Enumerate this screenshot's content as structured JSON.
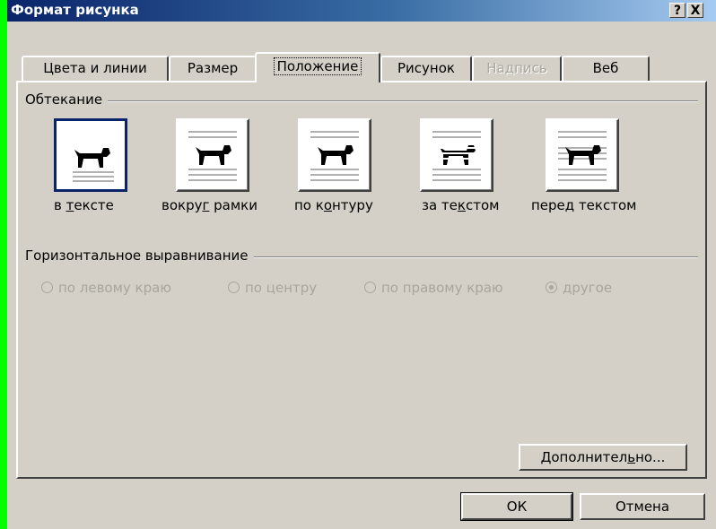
{
  "window": {
    "title": "Формат рисунка",
    "help_label": "?",
    "close_label": "X"
  },
  "tabs": [
    {
      "label": "Цвета и линии",
      "state": "normal"
    },
    {
      "label": "Размер",
      "state": "normal"
    },
    {
      "label": "Положение",
      "state": "active"
    },
    {
      "label": "Рисунок",
      "state": "normal"
    },
    {
      "label": "Надпись",
      "state": "disabled"
    },
    {
      "label": "Веб",
      "state": "normal"
    }
  ],
  "wrapping": {
    "group_label": "Обтекание",
    "options": [
      {
        "label_pre": "в ",
        "label_ul": "т",
        "label_post": "ексте",
        "icon": "wrap-inline-icon",
        "selected": true
      },
      {
        "label_pre": "вокру",
        "label_ul": "г",
        "label_post": " рамки",
        "icon": "wrap-square-icon",
        "selected": false
      },
      {
        "label_pre": "по к",
        "label_ul": "о",
        "label_post": "нтуру",
        "icon": "wrap-tight-icon",
        "selected": false
      },
      {
        "label_pre": "за те",
        "label_ul": "к",
        "label_post": "стом",
        "icon": "wrap-behind-icon",
        "selected": false
      },
      {
        "label_pre": "пере",
        "label_ul": "д",
        "label_post": " текстом",
        "icon": "wrap-infront-icon",
        "selected": false
      }
    ]
  },
  "horizontal_alignment": {
    "group_label": "Горизонтальное выравнивание",
    "options": [
      {
        "label": "по левому краю",
        "checked": false
      },
      {
        "label": "по центру",
        "checked": false
      },
      {
        "label": "по правому краю",
        "checked": false
      },
      {
        "label": "другое",
        "checked": true
      }
    ]
  },
  "advanced_button": {
    "label_pre": "Дополнител",
    "label_ul": "ь",
    "label_post": "но..."
  },
  "ok_label": "ОК",
  "cancel_label": "Отмена",
  "colors": {
    "titlebar_start": "#0a246a",
    "face": "#d4d0c8",
    "background": "#00ff00",
    "disabled_text": "#a8a59c"
  }
}
